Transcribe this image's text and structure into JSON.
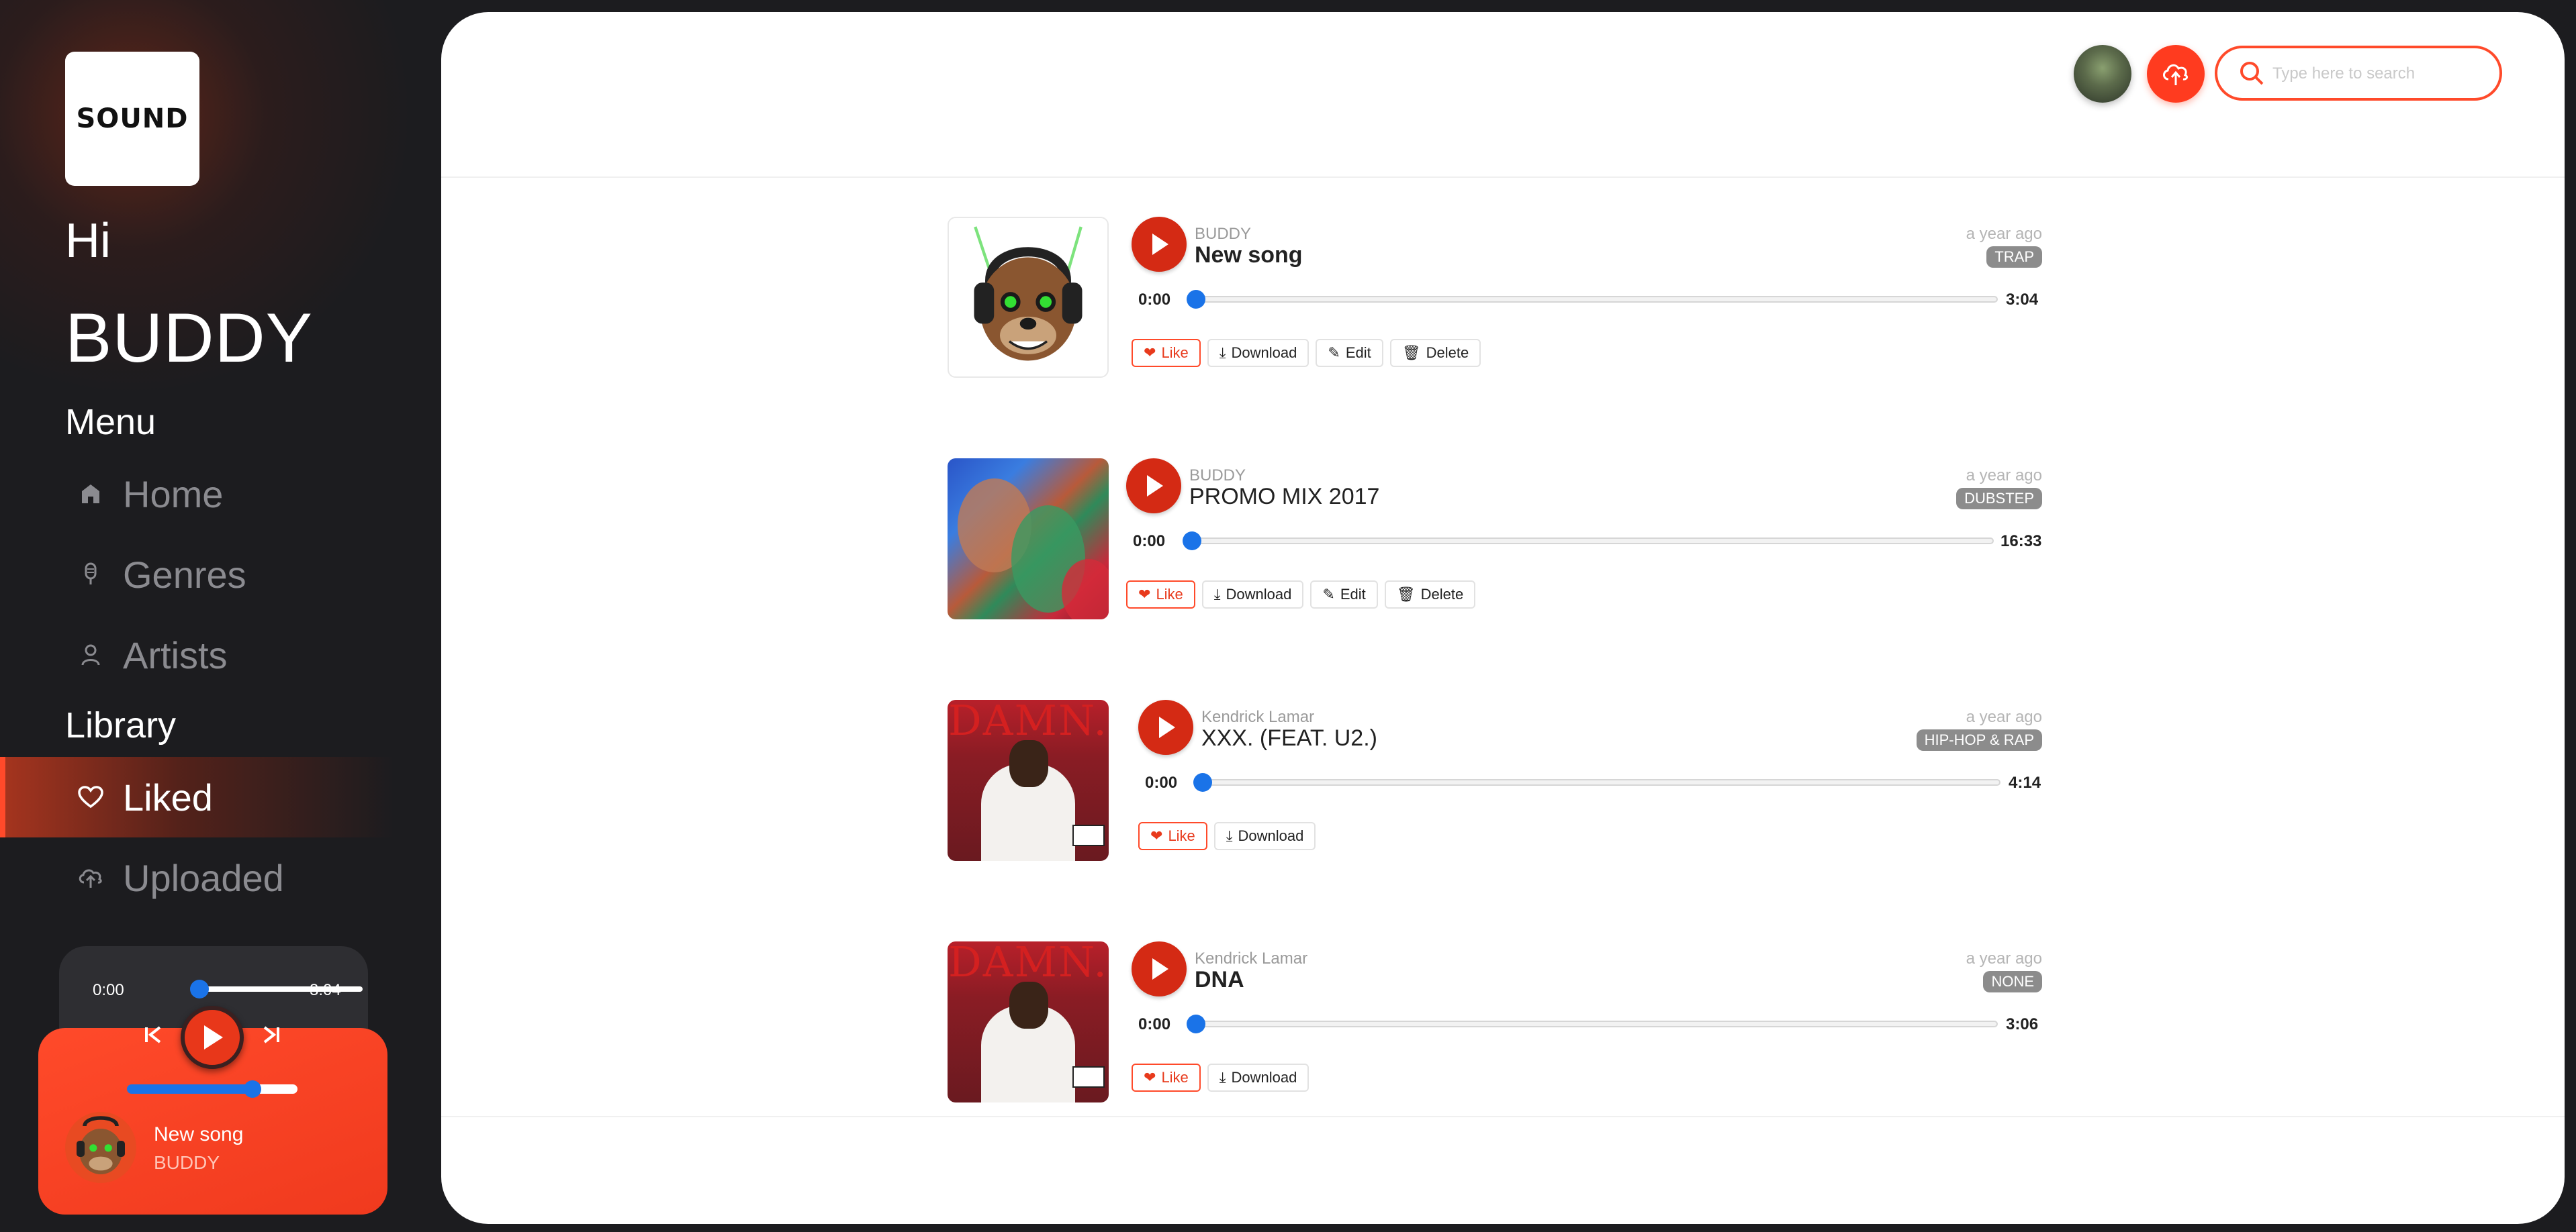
{
  "app": {
    "logo_text": "SOUND",
    "greeting": "Hi",
    "username": "BUDDY"
  },
  "sidebar": {
    "menu_title": "Menu",
    "library_title": "Library",
    "menu_items": [
      {
        "label": "Home",
        "icon": "home-icon"
      },
      {
        "label": "Genres",
        "icon": "microphone-icon"
      },
      {
        "label": "Artists",
        "icon": "user-icon"
      }
    ],
    "library_items": [
      {
        "label": "Liked",
        "icon": "heart-icon",
        "active": true
      },
      {
        "label": "Uploaded",
        "icon": "cloud-upload-icon",
        "active": false
      }
    ]
  },
  "player": {
    "current_time": "0:00",
    "duration": "3:04",
    "progress": 0,
    "volume": 0.72,
    "title": "New song",
    "artist": "BUDDY"
  },
  "header": {
    "search_placeholder": "Type here to search"
  },
  "colors": {
    "accent": "#ff4a2a",
    "play": "#d42a14",
    "slider": "#1a73e8",
    "sidebar_bg": "#1c1c1f"
  },
  "songs": [
    {
      "artist": "BUDDY",
      "title": "New song",
      "time_ago": "a year ago",
      "genre": "TRAP",
      "current_time": "0:00",
      "duration": "3:04",
      "actions": {
        "like": "Like",
        "download": "Download",
        "edit": "Edit",
        "delete": "Delete"
      }
    },
    {
      "artist": "BUDDY",
      "title": "PROMO MIX 2017",
      "time_ago": "a year ago",
      "genre": "DUBSTEP",
      "current_time": "0:00",
      "duration": "16:33",
      "actions": {
        "like": "Like",
        "download": "Download",
        "edit": "Edit",
        "delete": "Delete"
      }
    },
    {
      "artist": "Kendrick Lamar",
      "title": "XXX. (FEAT. U2.)",
      "time_ago": "a year ago",
      "genre": "HIP-HOP & RAP",
      "current_time": "0:00",
      "duration": "4:14",
      "cover_text": "DAMN.",
      "actions": {
        "like": "Like",
        "download": "Download"
      }
    },
    {
      "artist": "Kendrick Lamar",
      "title": "DNA",
      "time_ago": "a year ago",
      "genre": "NONE",
      "current_time": "0:00",
      "duration": "3:06",
      "cover_text": "DAMN.",
      "actions": {
        "like": "Like",
        "download": "Download"
      }
    }
  ]
}
